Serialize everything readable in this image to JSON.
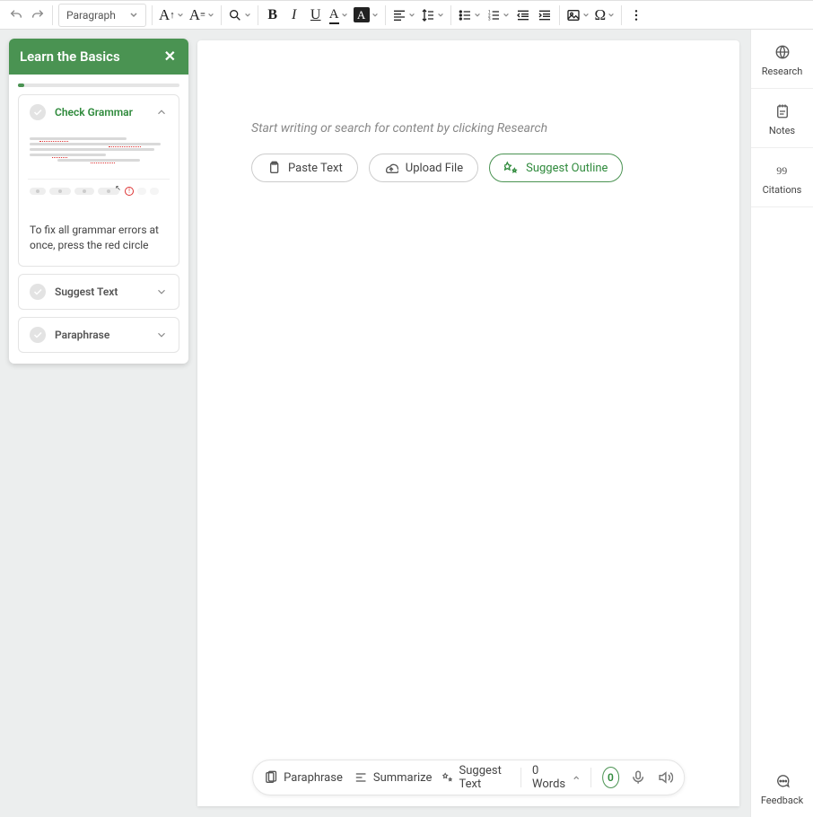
{
  "toolbar": {
    "paragraph_label": "Paragraph"
  },
  "panel": {
    "title": "Learn the Basics",
    "lessons": {
      "check_grammar": "Check Grammar",
      "check_grammar_desc": "To fix all grammar errors at once, press the red circle",
      "suggest_text": "Suggest Text",
      "paraphrase": "Paraphrase"
    }
  },
  "editor": {
    "placeholder": "Start writing or search for content by clicking Research",
    "paste_text": "Paste Text",
    "upload_file": "Upload File",
    "suggest_outline": "Suggest Outline"
  },
  "right_rail": {
    "research": "Research",
    "notes": "Notes",
    "citations": "Citations",
    "feedback": "Feedback"
  },
  "bottom_bar": {
    "paraphrase": "Paraphrase",
    "summarize": "Summarize",
    "suggest_text": "Suggest Text",
    "word_count_label": "0 Words",
    "error_badge": "0"
  }
}
